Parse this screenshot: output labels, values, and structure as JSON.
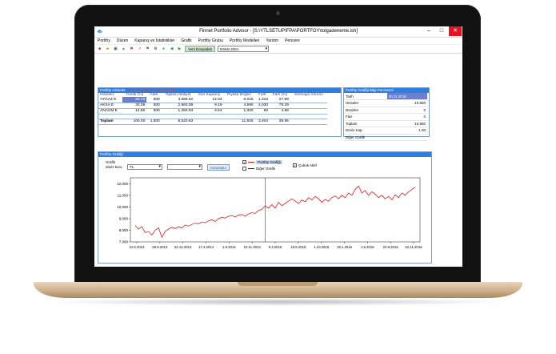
{
  "window": {
    "title": "Finnet Portfolio Advisor - [S:\\YTLSETUP\\FPA\\PORTFOY\\tolgadeneme.ish]",
    "minimize": "–",
    "maximize": "□",
    "close": "✕"
  },
  "menu": [
    "Portföy",
    "Düzen",
    "Kapanış ve İstatistikler",
    "Grafik",
    "Portföy Grubu",
    "Portföy Modelleri",
    "Yardım",
    "Pencere"
  ],
  "toolbar": {
    "new_file_label": "Yeni Dosyadan",
    "file_select_value": "ESMA.DDA"
  },
  "portfolio_pane": {
    "title": "Portföy Hisseler",
    "title_red": "Portföy Sistemi Özet Bilgileri",
    "columns": [
      "Hisseler",
      "Yüzde (%)",
      "Adet",
      "Toplam Maliyet",
      "Son Kapanış",
      "Piyasa Değeri",
      "Fark",
      "Fark (%)",
      "Sermaye Artırımı"
    ],
    "rows": [
      {
        "name": "AYGAZ E",
        "pct": "55.16",
        "adet": "500",
        "maliyet": "4,699.62",
        "kapanis": "12.03",
        "deger": "6,015",
        "fark": "1,315",
        "farkp": "27.99",
        "sermaye": ""
      },
      {
        "name": "AKSA E",
        "pct": "30.05",
        "adet": "500",
        "maliyet": "2,560.08",
        "kapanis": "9.18",
        "deger": "4,590",
        "fark": "2,030",
        "farkp": "79.29",
        "sermaye": ""
      },
      {
        "name": "ANACM E",
        "pct": "14.80",
        "adet": "500",
        "maliyet": "1,260.93",
        "kapanis": "2.64",
        "deger": "1,320",
        "fark": "59",
        "farkp": "4.68",
        "sermaye": ""
      }
    ],
    "total": {
      "name": "Toplam",
      "pct": "100.00",
      "adet": "1,500",
      "maliyet": "8,520.63",
      "kapanis": "",
      "deger": "11,925",
      "fark": "3,404",
      "farkp": "39.95",
      "sermaye": ""
    }
  },
  "info_pane": {
    "title": "Portföy Grafiği Bilgi Penceresi",
    "rows": [
      {
        "label": "Tarih",
        "value": "28.11.2016"
      },
      {
        "label": "Hisseler",
        "value": "10,560"
      },
      {
        "label": "Dövizler",
        "value": "0"
      },
      {
        "label": "Faiz",
        "value": "0"
      },
      {
        "label": "Toplam",
        "value": "10,560"
      },
      {
        "label": "Doviz Kap.",
        "value": "1.00"
      },
      {
        "label": "Diğer Grafik",
        "value": ""
      }
    ]
  },
  "chart_pane": {
    "title": "Portföy Grafiği",
    "label_grafik": "Grafik",
    "label_doviz": "döviz kuru",
    "select1_value": "TL",
    "select2_value": "",
    "compare_button": "Karşılaştır",
    "legend_portfolio": "Portföy Grafiği",
    "legend_other": "Diğer Grafik",
    "bar_label": "Çubuk Aktif"
  },
  "chart_data": {
    "type": "line",
    "ylim": [
      7000,
      12500
    ],
    "yticks": [
      12000,
      11000,
      10000,
      9000,
      8000,
      7000
    ],
    "yticklabels": [
      "12,000",
      "11,000",
      "10,000",
      "9,000",
      "8,000",
      "7,000"
    ],
    "xticklabels": [
      "21.5.2013",
      "29.8.2013",
      "22.12.2013",
      "17.4.2014",
      "1.8.2014",
      "10.11.2014",
      "8.3.2015",
      "18.6.2015",
      "1.10.2015",
      "19.1.2016",
      "1.5.2016",
      "24.8.2016",
      "22.11.2016"
    ],
    "series": [
      {
        "color": "#e11b1b",
        "values": [
          8400,
          8100,
          8300,
          7800,
          7900,
          7600,
          8000,
          8200,
          7400,
          7900,
          8100,
          8250,
          8150,
          8300,
          8200,
          8450,
          8350,
          8500,
          8600,
          8550,
          8700,
          8650,
          8800,
          8900,
          8750,
          9000,
          9100,
          9050,
          9200,
          9250,
          9150,
          9300,
          9350,
          9200,
          9400,
          9500,
          9450,
          9700,
          9800,
          10100,
          9900,
          10200,
          9900,
          10400,
          10100,
          10300,
          10500,
          10700,
          10500,
          10300,
          10600,
          10450,
          10800,
          10600,
          10900,
          10700,
          10400,
          10650,
          10500,
          10800,
          10950,
          10700,
          11000,
          10800,
          11200,
          11000,
          11500,
          11800,
          11200,
          11400,
          11000,
          11300,
          11100,
          10800,
          11000,
          10700,
          10900,
          10600,
          11050,
          10800,
          11200,
          11000,
          11300,
          11500,
          11700
        ]
      }
    ],
    "cursor_index": 39
  }
}
